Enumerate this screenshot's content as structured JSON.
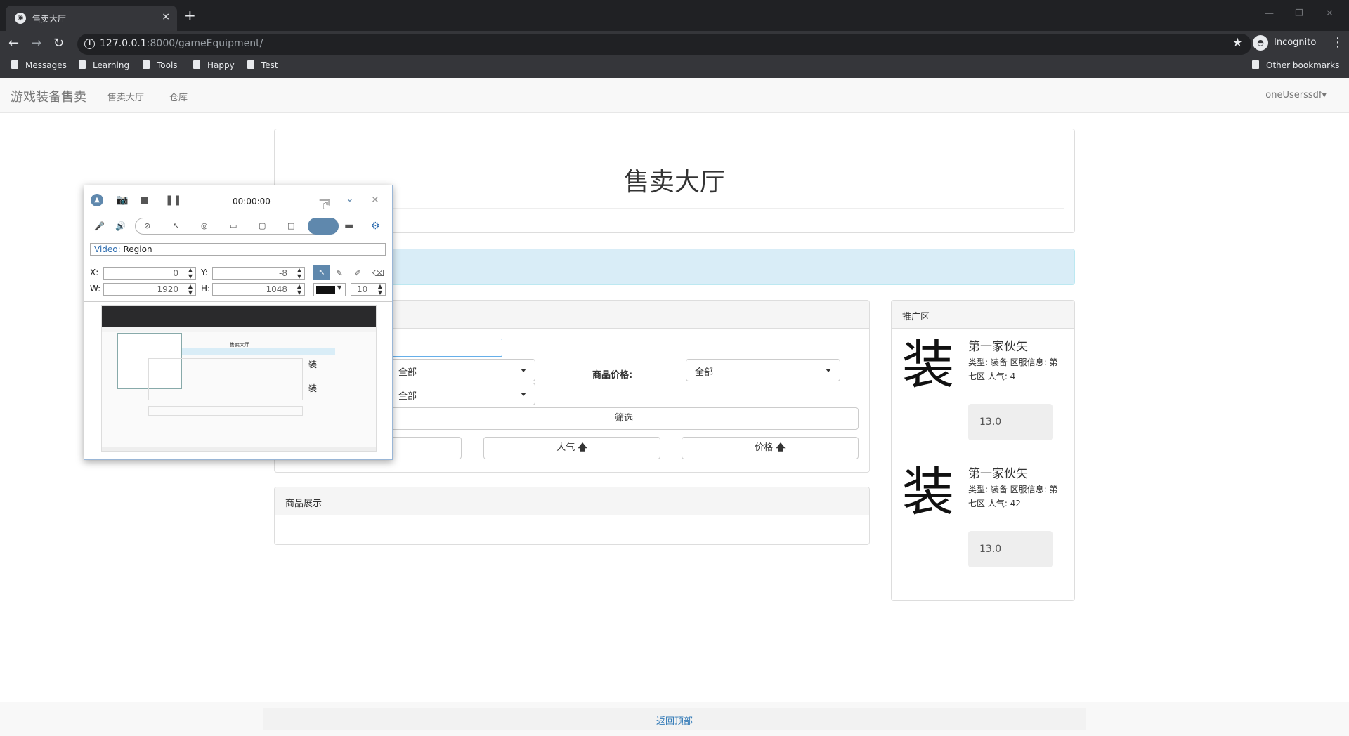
{
  "browser": {
    "tab_title": "售卖大厅",
    "tab_close": "×",
    "new_tab": "+",
    "url_host": "127.0.0.1",
    "url_rest": ":8000/gameEquipment/",
    "incognito_label": "Incognito",
    "bookmarks": [
      "Messages",
      "Learning",
      "Tools",
      "Happy",
      "Test"
    ],
    "other_bookmarks": "Other bookmarks"
  },
  "navbar": {
    "brand": "游戏装备售卖",
    "links": [
      "售卖大厅",
      "仓库"
    ],
    "user": "oneUserssdf▾"
  },
  "hero": {
    "title": "售卖大厅"
  },
  "filter": {
    "select_1": "全部",
    "select_2": "全部",
    "price_label": "商品价格:",
    "price_select": "全部",
    "filter_button": "筛选",
    "sort_popularity": "人气",
    "sort_price": "价格",
    "sort_arrow": "🡅"
  },
  "products_panel": {
    "heading": "商品展示"
  },
  "promo": {
    "heading": "推广区",
    "items": [
      {
        "char": "装",
        "name": "第一家伙矢",
        "info": "类型: 装备  区服信息: 第七区  人气: 4",
        "price": "13.0"
      },
      {
        "char": "装",
        "name": "第一家伙矢",
        "info": "类型: 装备  区服信息: 第七区  人气: 42",
        "price": "13.0"
      }
    ]
  },
  "footer": {
    "back_to_top": "返回顶部"
  },
  "recorder": {
    "time": "00:00:00",
    "mode_key": "Video:",
    "mode_value": "Region",
    "x_label": "X:",
    "x_value": "0",
    "y_label": "Y:",
    "y_value": "-8",
    "w_label": "W:",
    "w_value": "1920",
    "h_label": "H:",
    "h_value": "1048",
    "line_width": "10",
    "thumb_title": "售卖大厅"
  },
  "colors": {
    "chrome_dark": "#202124",
    "chrome_toolbar": "#35363a",
    "alert_info": "#d9edf7",
    "link": "#337ab7",
    "recorder_accent": "#5f88ad"
  }
}
